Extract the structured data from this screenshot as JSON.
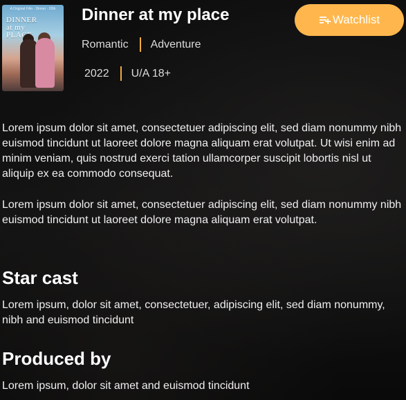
{
  "movie": {
    "title": "Dinner at my place",
    "poster": {
      "top_text": "A Original Film · Dinner · 20th",
      "title_text": "DINNER at my PLACE"
    },
    "genres": [
      "Romantic",
      "Adventure"
    ],
    "year": "2022",
    "rating": "U/A 18+"
  },
  "actions": {
    "watchlist_label": "Watchlist",
    "watchlist_icon": "playlist-add-icon"
  },
  "description": [
    "Lorem ipsum dolor sit amet, consectetuer adipiscing elit, sed diam nonummy nibh euismod tincidunt ut laoreet dolore magna aliquam erat volutpat. Ut wisi enim ad minim veniam, quis nostrud exerci tation ullamcorper suscipit lobortis nisl ut aliquip ex ea commodo consequat.",
    "Lorem ipsum dolor sit amet, consectetuer adipiscing elit, sed diam nonummy nibh euismod tincidunt ut laoreet dolore magna aliquam erat volutpat."
  ],
  "star_cast": {
    "heading": "Star cast",
    "text": "Lorem ipsum, dolor sit amet, consectetuer, adipiscing elit, sed diam nonummy, nibh and euismod tincidunt"
  },
  "produced_by": {
    "heading": "Produced by",
    "text": "Lorem ipsum, dolor sit amet and euismod tincidunt"
  },
  "colors": {
    "accent": "#ffb74d",
    "separator": "#f2ad3c",
    "background": "#0b0b0c"
  }
}
